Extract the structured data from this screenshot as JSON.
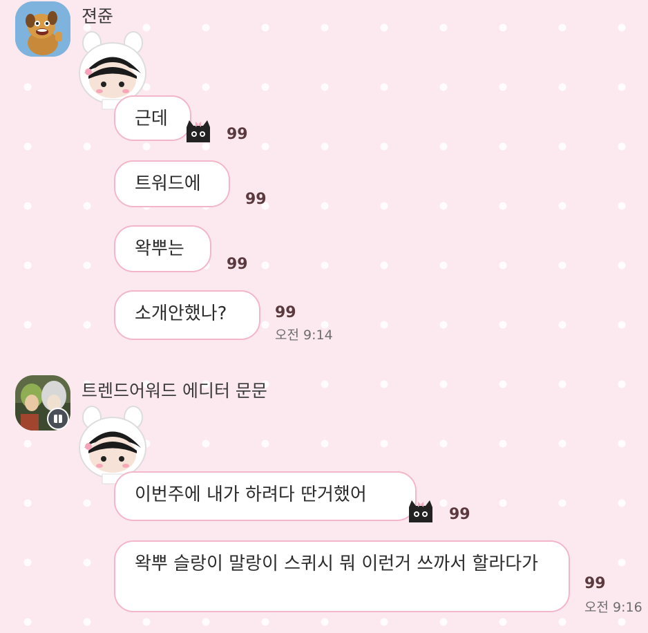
{
  "messages_group_1": {
    "sender": "젼쥰",
    "bubbles": [
      {
        "text": "근데",
        "count": "99"
      },
      {
        "text": "트워드에",
        "count": "99"
      },
      {
        "text": "왁뿌는",
        "count": "99"
      },
      {
        "text": "소개안했나?",
        "count": "99",
        "time": "오전 9:14"
      }
    ]
  },
  "messages_group_2": {
    "sender": "트렌드어워드 에디터 문문",
    "bubbles": [
      {
        "text": "이번주에 내가 하려다 딴거했어",
        "count": "99"
      },
      {
        "text": "왁뿌 슬랑이 말랑이 스퀴시 뭐 이런거 쓰까서 할라다가",
        "count": "99",
        "time": "오전 9:16"
      }
    ]
  },
  "colors": {
    "background": "#fce9ef",
    "bubble_border": "#f3b6c8",
    "badge_text": "#5b3a3f"
  }
}
